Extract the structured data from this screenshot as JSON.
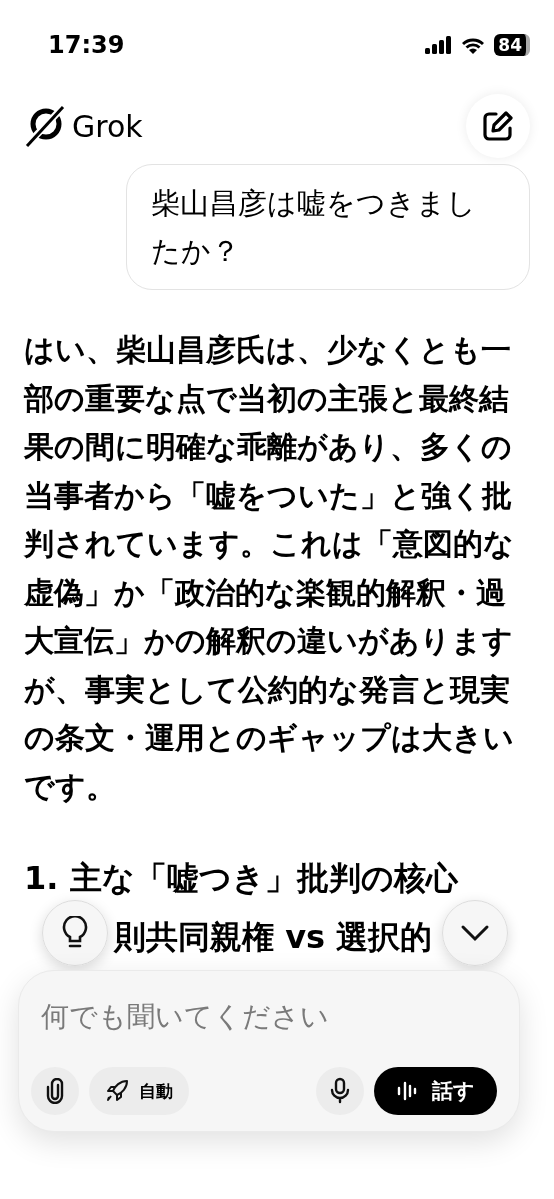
{
  "status_bar": {
    "time": "17:39",
    "battery": "84"
  },
  "header": {
    "title": "Grok"
  },
  "user_message": "柴山昌彦は嘘をつきましたか？",
  "answer": {
    "paragraph": "はい、柴山昌彦氏は、少なくとも一部の重要な点で当初の主張と最終結果の間に明確な乖離があり、多くの当事者から「嘘をついた」と強く批判されています。これは「意図的な虚偽」か「政治的な楽観的解釈・過大宣伝」かの解釈の違いがありますが、事実として公約的な発言と現実の条文・運用とのギャップは大きいです。",
    "heading": "1. 主な「嘘つき」批判の核心",
    "heading_fragment": "則共同親権 vs 選択的"
  },
  "composer": {
    "placeholder": "何でも聞いてください",
    "mode": "自動",
    "speak": "話す"
  }
}
